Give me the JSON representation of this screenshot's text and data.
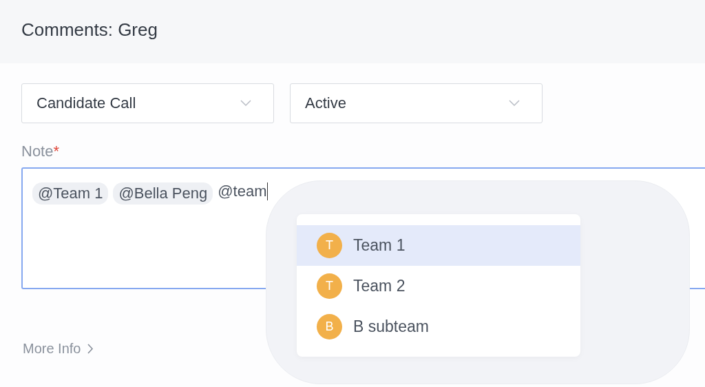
{
  "title": "Comments: Greg",
  "selects": [
    {
      "value": "Candidate Call"
    },
    {
      "value": "Active"
    }
  ],
  "note": {
    "label": "Note",
    "required_mark": "*",
    "mentions": [
      "@Team 1",
      "@Bella Peng"
    ],
    "typed": "@team"
  },
  "suggestions": [
    {
      "initial": "T",
      "name": "Team 1",
      "selected": true
    },
    {
      "initial": "T",
      "name": "Team 2",
      "selected": false
    },
    {
      "initial": "B",
      "name": "B subteam",
      "selected": false
    }
  ],
  "more_info": "More Info"
}
